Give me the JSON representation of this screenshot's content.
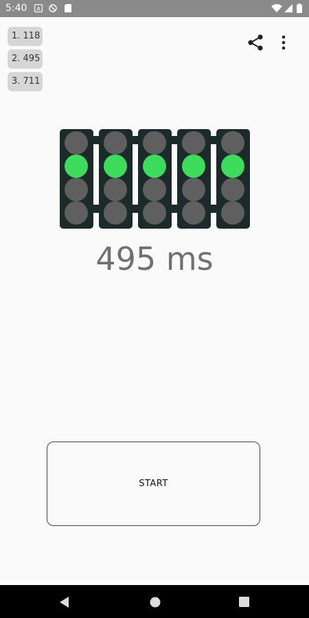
{
  "status_bar": {
    "time": "5:40",
    "icons": [
      "notification-a-icon",
      "blocked-circle-icon",
      "sd-card-icon",
      "wifi-icon",
      "signal-icon",
      "battery-icon"
    ]
  },
  "scores": [
    {
      "label": "1. 118"
    },
    {
      "label": "2. 495"
    },
    {
      "label": "3. 711"
    }
  ],
  "toolbar": {
    "share_icon": "share-icon",
    "menu_icon": "more-vert-icon"
  },
  "traffic_lights": {
    "count": 5,
    "lit_row": 2,
    "lit_color": "#3ddc5c",
    "off_color": "#5f5f5f",
    "housing_color": "#1d2a2b"
  },
  "result": {
    "text": "495 ms"
  },
  "start_button": {
    "label": "START"
  },
  "nav_bar": {
    "icons": [
      "back-icon",
      "home-icon",
      "recents-icon"
    ]
  }
}
